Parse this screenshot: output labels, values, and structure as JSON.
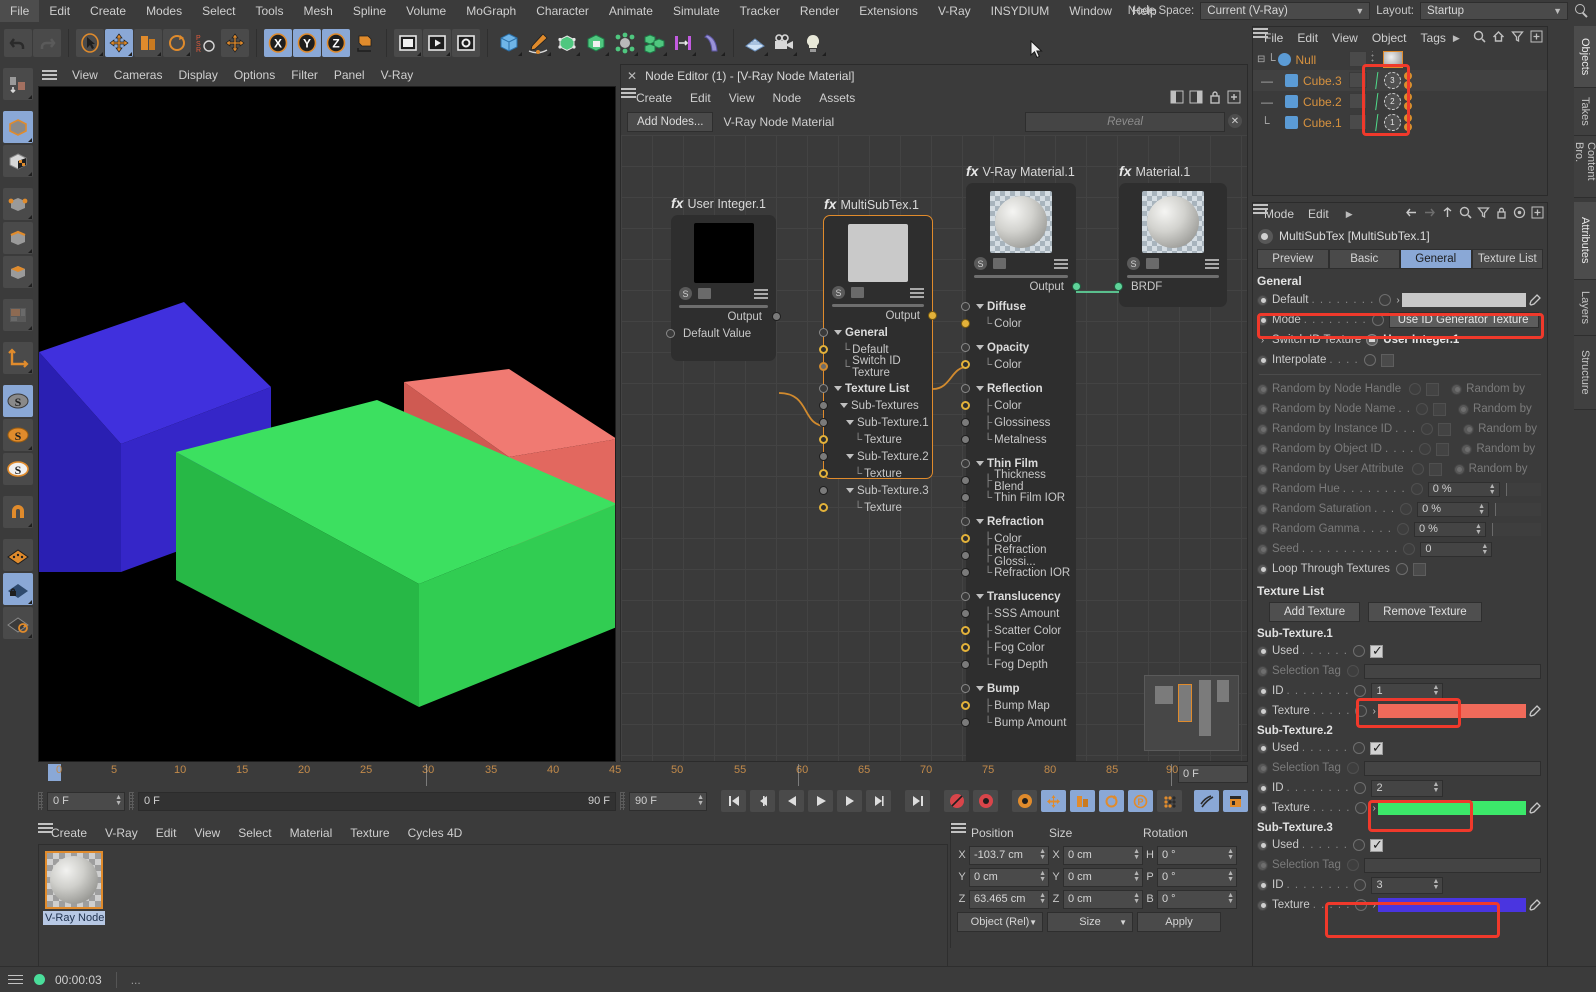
{
  "app": {
    "menu": [
      "File",
      "Edit",
      "Create",
      "Modes",
      "Select",
      "Tools",
      "Mesh",
      "Spline",
      "Volume",
      "MoGraph",
      "Character",
      "Animate",
      "Simulate",
      "Tracker",
      "Render",
      "Extensions",
      "V-Ray",
      "INSYDIUM",
      "Window",
      "Help"
    ],
    "node_space_label": "Node Space:",
    "node_space_value": "Current (V-Ray)",
    "layout_label": "Layout:",
    "layout_value": "Startup"
  },
  "viewport": {
    "menu": [
      "View",
      "Cameras",
      "Display",
      "Options",
      "Filter",
      "Panel",
      "V-Ray"
    ],
    "cubes": [
      {
        "name": "blue-cube",
        "color": "#3a2fd0"
      },
      {
        "name": "red-cube",
        "color": "#e05a50"
      },
      {
        "name": "green-cube",
        "color": "#33e05a"
      }
    ]
  },
  "timeline": {
    "ticks": [
      0,
      5,
      10,
      15,
      20,
      25,
      30,
      35,
      40,
      45,
      50,
      55,
      60,
      65,
      70,
      75,
      80,
      85,
      90
    ],
    "current_frame_box": "0 F",
    "start_field": "0 F",
    "current_field": "0 F",
    "end_field_left": "90 F",
    "end_field_right": "90 F"
  },
  "material_manager": {
    "menu": [
      "Create",
      "V-Ray",
      "Edit",
      "View",
      "Select",
      "Material",
      "Texture",
      "Cycles 4D"
    ],
    "materials": [
      {
        "label": "V-Ray Node",
        "selected": true
      }
    ]
  },
  "coordinates": {
    "headers": [
      "Position",
      "Size",
      "Rotation"
    ],
    "rows": [
      {
        "pos_axis": "X",
        "pos": "-103.7 cm",
        "size_axis": "X",
        "size": "0 cm",
        "rot_axis": "H",
        "rot": "0 °"
      },
      {
        "pos_axis": "Y",
        "pos": "0 cm",
        "size_axis": "Y",
        "size": "0 cm",
        "rot_axis": "P",
        "rot": "0 °"
      },
      {
        "pos_axis": "Z",
        "pos": "63.465 cm",
        "size_axis": "Z",
        "size": "0 cm",
        "rot_axis": "B",
        "rot": "0 °"
      }
    ],
    "mode_select": "Object (Rel)",
    "size_select": "Size",
    "apply_button": "Apply"
  },
  "node_editor": {
    "title": "Node Editor (1) - [V-Ray Node Material]",
    "menu": [
      "Create",
      "Edit",
      "View",
      "Node",
      "Assets"
    ],
    "add_nodes_button": "Add Nodes...",
    "material_name": "V-Ray Node Material",
    "reveal_placeholder": "Reveal",
    "nodes": [
      {
        "name": "User Integer.1",
        "prefix": "fx",
        "output_label": "Output",
        "ports": [
          {
            "label": "Default Value",
            "dot": "hollow",
            "indent": 0,
            "header": false
          }
        ]
      },
      {
        "name": "MultiSubTex.1",
        "prefix": "fx",
        "selected": true,
        "output_label": "Output",
        "ports": [
          {
            "label": "General",
            "dot": "hollow",
            "indent": 0,
            "header": true
          },
          {
            "label": "Default",
            "dot": "yo",
            "indent": 1,
            "header": false
          },
          {
            "label": "Switch ID Texture",
            "dot": "connected",
            "indent": 1,
            "header": false
          },
          {
            "label": "Texture List",
            "dot": "hollow",
            "indent": 0,
            "header": true
          },
          {
            "label": "Sub-Textures",
            "dot": "gray",
            "indent": 1,
            "header": false
          },
          {
            "label": "Sub-Texture.1",
            "dot": "gray",
            "indent": 2,
            "header": false
          },
          {
            "label": "Texture",
            "dot": "yo",
            "indent": 3,
            "header": false
          },
          {
            "label": "Sub-Texture.2",
            "dot": "gray",
            "indent": 2,
            "header": false
          },
          {
            "label": "Texture",
            "dot": "yo",
            "indent": 3,
            "header": false
          },
          {
            "label": "Sub-Texture.3",
            "dot": "gray",
            "indent": 2,
            "header": false
          },
          {
            "label": "Texture",
            "dot": "yo",
            "indent": 3,
            "header": false
          }
        ]
      },
      {
        "name": "V-Ray Material.1",
        "prefix": "fx",
        "output_label": "Output",
        "ports": [
          {
            "label": "Diffuse",
            "dot": "hollow",
            "indent": 0,
            "header": true
          },
          {
            "label": "Color",
            "dot": "y",
            "indent": 1,
            "header": false
          },
          {
            "label": "Opacity",
            "dot": "hollow",
            "indent": 0,
            "header": true
          },
          {
            "label": "Color",
            "dot": "yo",
            "indent": 1,
            "header": false
          },
          {
            "label": "Reflection",
            "dot": "hollow",
            "indent": 0,
            "header": true
          },
          {
            "label": "Color",
            "dot": "yo",
            "indent": 1,
            "header": false
          },
          {
            "label": "Glossiness",
            "dot": "gray",
            "indent": 1,
            "header": false
          },
          {
            "label": "Metalness",
            "dot": "gray",
            "indent": 1,
            "header": false
          },
          {
            "label": "Thin Film",
            "dot": "hollow",
            "indent": 0,
            "header": true
          },
          {
            "label": "Thickness Blend",
            "dot": "gray",
            "indent": 1,
            "header": false
          },
          {
            "label": "Thin Film IOR",
            "dot": "gray",
            "indent": 1,
            "header": false
          },
          {
            "label": "Refraction",
            "dot": "hollow",
            "indent": 0,
            "header": true
          },
          {
            "label": "Color",
            "dot": "yo",
            "indent": 1,
            "header": false
          },
          {
            "label": "Refraction Glossi...",
            "dot": "gray",
            "indent": 1,
            "header": false
          },
          {
            "label": "Refraction IOR",
            "dot": "gray",
            "indent": 1,
            "header": false
          },
          {
            "label": "Translucency",
            "dot": "hollow",
            "indent": 0,
            "header": true
          },
          {
            "label": "SSS Amount",
            "dot": "gray",
            "indent": 1,
            "header": false
          },
          {
            "label": "Scatter Color",
            "dot": "yo",
            "indent": 1,
            "header": false
          },
          {
            "label": "Fog Color",
            "dot": "yo",
            "indent": 1,
            "header": false
          },
          {
            "label": "Fog Depth",
            "dot": "gray",
            "indent": 1,
            "header": false
          },
          {
            "label": "Bump",
            "dot": "hollow",
            "indent": 0,
            "header": true
          },
          {
            "label": "Bump Map",
            "dot": "yo",
            "indent": 1,
            "header": false
          },
          {
            "label": "Bump Amount",
            "dot": "gray",
            "indent": 1,
            "header": false
          }
        ]
      },
      {
        "name": "Material.1",
        "prefix": "fx",
        "input_label": "BRDF",
        "ports": []
      }
    ]
  },
  "object_manager": {
    "menu": [
      "File",
      "Edit",
      "View",
      "Object",
      "Tags"
    ],
    "rows": [
      {
        "name": "Null",
        "type": "null",
        "indent": 0,
        "tag": null
      },
      {
        "name": "Cube.3",
        "type": "cube",
        "indent": 1,
        "tag": "3"
      },
      {
        "name": "Cube.2",
        "type": "cube",
        "indent": 1,
        "tag": "2"
      },
      {
        "name": "Cube.1",
        "type": "cube",
        "indent": 1,
        "tag": "1"
      }
    ]
  },
  "attribute_manager": {
    "menu": [
      "Mode",
      "Edit"
    ],
    "object_title": "MultiSubTex [MultiSubTex.1]",
    "tabs": [
      {
        "label": "Preview",
        "active": false
      },
      {
        "label": "Basic",
        "active": false
      },
      {
        "label": "General",
        "active": true
      },
      {
        "label": "Texture List",
        "active": false
      }
    ],
    "general_header": "General",
    "general_rows": [
      {
        "label": "Default",
        "dots": ". . . . . . . .",
        "control": "swatch",
        "value": "",
        "color": "#c8c8c8",
        "dim": false
      },
      {
        "label": "Mode",
        "dots": ". . . . . . . .",
        "control": "dropdown",
        "value": "Use ID Generator Texture",
        "dim": false,
        "highlight": true
      },
      {
        "label": "Switch ID Texture",
        "dots": "",
        "control": "link",
        "value": "User Integer.1",
        "dim": false
      },
      {
        "label": "Interpolate",
        "dots": ". . . .",
        "control": "checkbox",
        "checked": false,
        "dim": false
      }
    ],
    "random_rows": [
      {
        "label": "Random by Node Handle",
        "dots": "",
        "control": "checkbox",
        "right": "Random by",
        "dim": true
      },
      {
        "label": "Random by Node Name",
        "dots": ". .",
        "control": "checkbox",
        "right": "Random by",
        "dim": true
      },
      {
        "label": "Random by Instance ID",
        "dots": ". . .",
        "control": "checkbox",
        "right": "Random by",
        "dim": true
      },
      {
        "label": "Random by Object ID",
        "dots": ". . . .",
        "control": "checkbox",
        "right": "Random by",
        "dim": true
      },
      {
        "label": "Random by User Attribute",
        "dots": "",
        "control": "checkbox",
        "right": "Random by",
        "dim": true
      }
    ],
    "numeric_rows": [
      {
        "label": "Random Hue",
        "dots": ". . . . . . . .",
        "value": "0 %",
        "dim": true
      },
      {
        "label": "Random Saturation",
        "dots": ". . .",
        "value": "0 %",
        "dim": true
      },
      {
        "label": "Random Gamma",
        "dots": ". . . .",
        "value": "0 %",
        "dim": true
      },
      {
        "label": "Seed",
        "dots": ". . . . . . . . . . . .",
        "value": "0",
        "dim": true
      }
    ],
    "loop_row": {
      "label": "Loop Through Textures",
      "checked": false
    },
    "texture_list_header": "Texture List",
    "add_texture_button": "Add Texture",
    "remove_texture_button": "Remove Texture",
    "sub_textures": [
      {
        "header": "Sub-Texture.1",
        "used_label": "Used",
        "used_dots": ". . . . . .",
        "used_checked": true,
        "selection_tag_label": "Selection Tag",
        "selection_tag_value": "",
        "id_label": "ID",
        "id_dots": ". . . . . . . .",
        "id_value": "1",
        "texture_label": "Texture",
        "texture_dots": ". . . . .",
        "texture_color": "#f06a5a"
      },
      {
        "header": "Sub-Texture.2",
        "used_label": "Used",
        "used_dots": ". . . . . .",
        "used_checked": true,
        "selection_tag_label": "Selection Tag",
        "selection_tag_value": "",
        "id_label": "ID",
        "id_dots": ". . . . . . . .",
        "id_value": "2",
        "texture_label": "Texture",
        "texture_dots": ". . . . .",
        "texture_color": "#3ce86a"
      },
      {
        "header": "Sub-Texture.3",
        "used_label": "Used",
        "used_dots": ". . . . . .",
        "used_checked": true,
        "selection_tag_label": "Selection Tag",
        "selection_tag_value": "",
        "id_label": "ID",
        "id_dots": ". . . . . . . .",
        "id_value": "3",
        "texture_label": "Texture",
        "texture_dots": ". . . . .",
        "texture_color": "#4a35e0"
      }
    ]
  },
  "right_tabs_top": [
    "Objects",
    "Takes",
    "Content Bro."
  ],
  "right_tabs_bottom": [
    "Attributes",
    "Layers",
    "Structure"
  ],
  "status_bar": {
    "time": "00:00:03",
    "message": "..."
  },
  "colors": {
    "accent_orange": "#e08b2c",
    "highlight_blue": "#8aa8d6",
    "annotation_red": "#f0392b",
    "panel_bg": "#3b3b3b"
  }
}
